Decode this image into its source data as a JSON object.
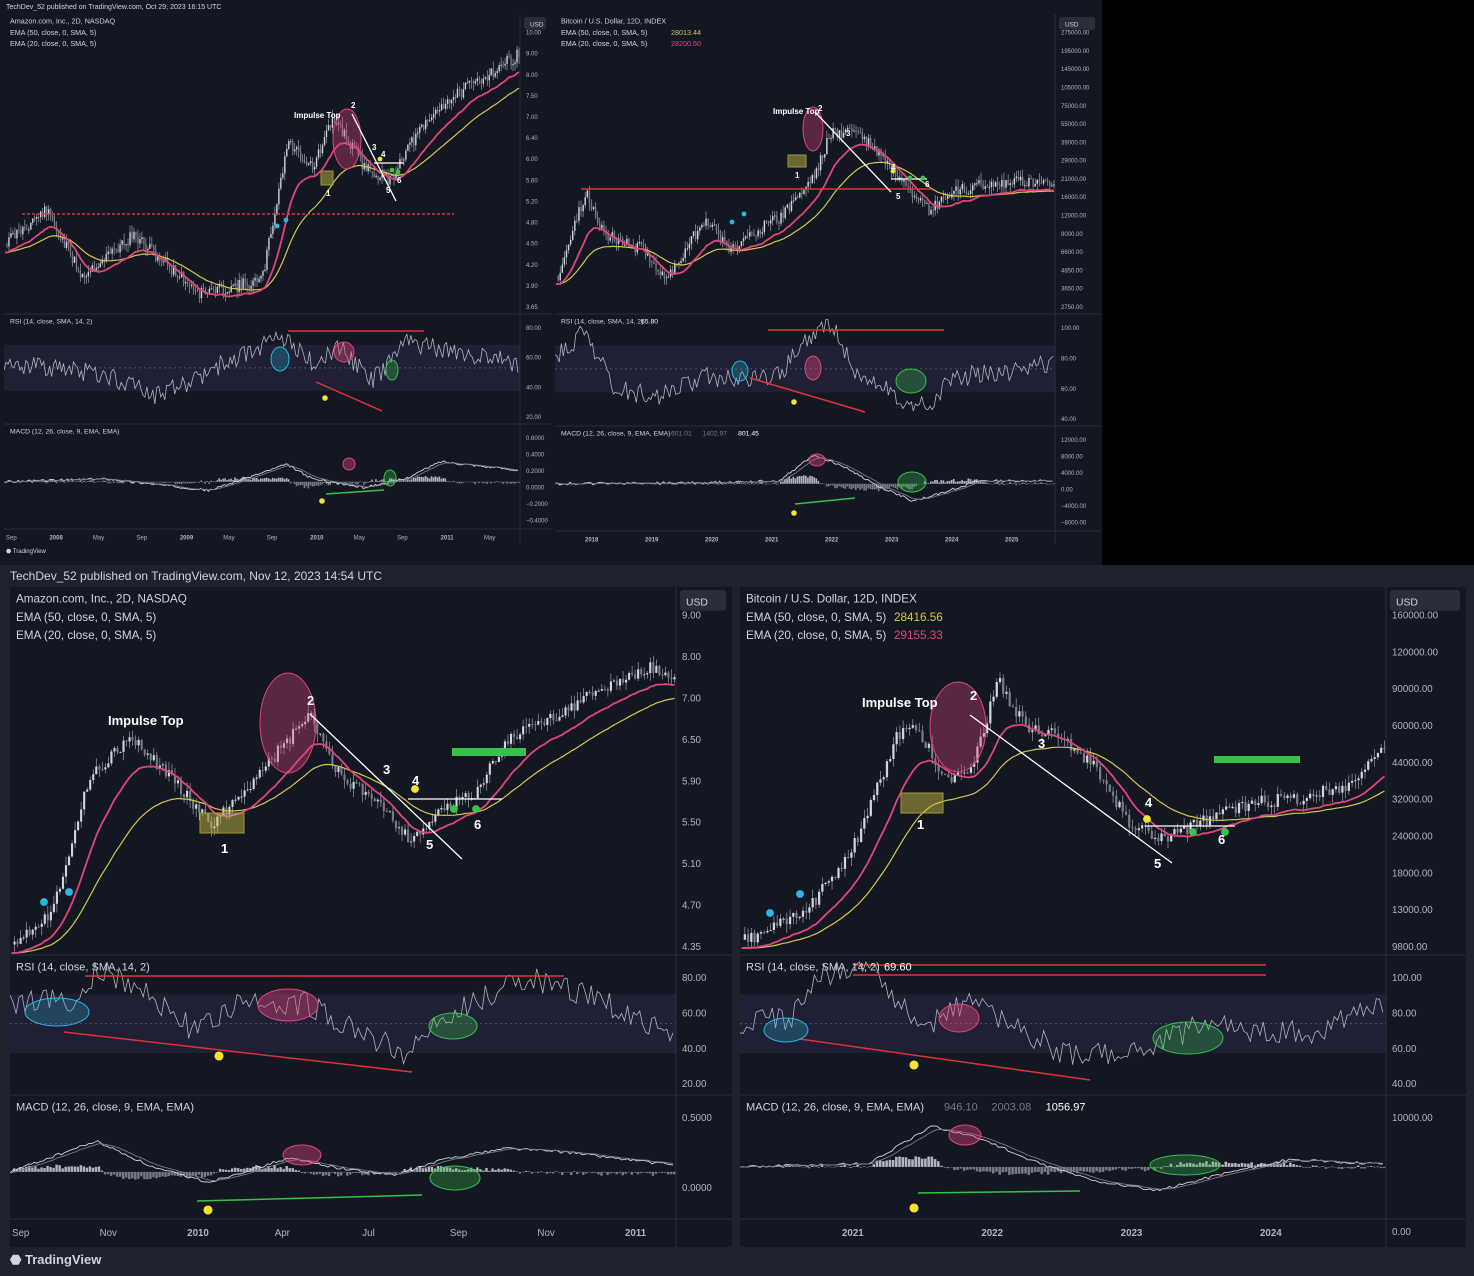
{
  "top_publish": "TechDev_52 published on TradingView.com, Oct 29, 2023 16:15 UTC",
  "bottom_publish": "TechDev_52 published on TradingView.com, Nov 12, 2023 14:54 UTC",
  "tradingview_logo": "TradingView",
  "colors": {
    "background": "#131722",
    "up": "#d1d4dc",
    "ema50": "#d4c94a",
    "ema20": "#e0457b",
    "resistance": "#e0323c",
    "teal_dot": "#2ab8e0",
    "yellow_dot": "#f5e12f",
    "green_dot": "#37c24a"
  },
  "chart_data": [
    {
      "id": "amzn-top",
      "type": "candlestick",
      "title": "Amazon.com, Inc., 2D, NASDAQ",
      "legend": [
        "EMA (50, close, 0, SMA, 5)",
        "EMA (20, close, 0, SMA, 5)"
      ],
      "currency": "USD",
      "price_ticks": [
        "10.00",
        "9.00",
        "8.00",
        "7.50",
        "7.00",
        "6.40",
        "6.00",
        "5.60",
        "5.20",
        "4.80",
        "4.50",
        "4.20",
        "3.90",
        "3.65"
      ],
      "annotations": [
        "Impulse Top",
        "1",
        "2",
        "3",
        "4",
        "5",
        "6"
      ],
      "rsi_label": "RSI (14, close, SMA, 14, 2)",
      "rsi_ticks": [
        "80.00",
        "60.00",
        "40.00",
        "20.00"
      ],
      "macd_label": "MACD (12, 26, close, 9, EMA, EMA)",
      "macd_ticks": [
        "0.6000",
        "0.4000",
        "0.2000",
        "0.0000",
        "−0.2000",
        "−0.4000"
      ],
      "x_ticks": [
        "Sep",
        "2008",
        "May",
        "Sep",
        "2009",
        "May",
        "Sep",
        "2010",
        "May",
        "Sep",
        "2011",
        "May"
      ]
    },
    {
      "id": "btc-top",
      "type": "candlestick",
      "title": "Bitcoin / U.S. Dollar, 12D, INDEX",
      "legend": [
        "EMA (50, close, 0, SMA, 5)",
        "EMA (20, close, 0, SMA, 5)"
      ],
      "legend_values": [
        "28013.44",
        "28200.50"
      ],
      "currency": "USD",
      "price_ticks": [
        "275000.00",
        "195000.00",
        "145000.00",
        "105000.00",
        "75000.00",
        "55000.00",
        "39000.00",
        "29000.00",
        "21000.00",
        "16000.00",
        "12000.00",
        "9000.00",
        "6600.00",
        "4850.00",
        "3650.00",
        "2750.00"
      ],
      "annotations": [
        "Impulse Top",
        "1",
        "2",
        "3",
        "4",
        "5",
        "6"
      ],
      "rsi_label": "RSI (14, close, SMA, 14, 2)",
      "rsi_value": "65.80",
      "rsi_ticks": [
        "100.00",
        "80.00",
        "60.00",
        "40.00"
      ],
      "macd_label": "MACD (12, 26, close, 9, EMA, EMA)",
      "macd_values": [
        "601.01",
        "1402.97",
        "801.45"
      ],
      "macd_ticks": [
        "12000.00",
        "8000.00",
        "4000.00",
        "0.00",
        "−4000.00",
        "−8000.00"
      ],
      "x_ticks": [
        "2018",
        "2019",
        "2020",
        "2021",
        "2022",
        "2023",
        "2024",
        "2025"
      ]
    },
    {
      "id": "amzn-bottom",
      "type": "candlestick",
      "title": "Amazon.com, Inc., 2D, NASDAQ",
      "legend": [
        "EMA (50, close, 0, SMA, 5)",
        "EMA (20, close, 0, SMA, 5)"
      ],
      "currency": "USD",
      "price_ticks": [
        "9.00",
        "8.00",
        "7.00",
        "6.50",
        "5.90",
        "5.50",
        "5.10",
        "4.70",
        "4.35"
      ],
      "annotations": [
        "Impulse Top",
        "1",
        "2",
        "3",
        "4",
        "5",
        "6"
      ],
      "rsi_label": "RSI (14, close, SMA, 14, 2)",
      "rsi_ticks": [
        "80.00",
        "60.00",
        "40.00",
        "20.00"
      ],
      "macd_label": "MACD (12, 26, close, 9, EMA, EMA)",
      "macd_ticks": [
        "0.5000",
        "0.0000"
      ],
      "x_ticks": [
        "Sep",
        "Nov",
        "2010",
        "Apr",
        "Jul",
        "Sep",
        "Nov",
        "2011"
      ]
    },
    {
      "id": "btc-bottom",
      "type": "candlestick",
      "title": "Bitcoin / U.S. Dollar, 12D, INDEX",
      "legend": [
        "EMA (50, close, 0, SMA, 5)",
        "EMA (20, close, 0, SMA, 5)"
      ],
      "legend_values": [
        "28416.56",
        "29155.33"
      ],
      "currency": "USD",
      "price_ticks": [
        "160000.00",
        "120000.00",
        "90000.00",
        "60000.00",
        "44000.00",
        "32000.00",
        "24000.00",
        "18000.00",
        "13000.00",
        "9800.00"
      ],
      "annotations": [
        "Impulse Top",
        "1",
        "2",
        "3",
        "4",
        "5",
        "6"
      ],
      "rsi_label": "RSI (14, close, SMA, 14, 2)",
      "rsi_value": "69.60",
      "rsi_ticks": [
        "100.00",
        "80.00",
        "60.00",
        "40.00"
      ],
      "macd_label": "MACD (12, 26, close, 9, EMA, EMA)",
      "macd_values": [
        "946.10",
        "2003.08",
        "1056.97"
      ],
      "macd_ticks": [
        "10000.00",
        "0.00"
      ],
      "x_ticks": [
        "2021",
        "2022",
        "2023",
        "2024"
      ]
    }
  ]
}
